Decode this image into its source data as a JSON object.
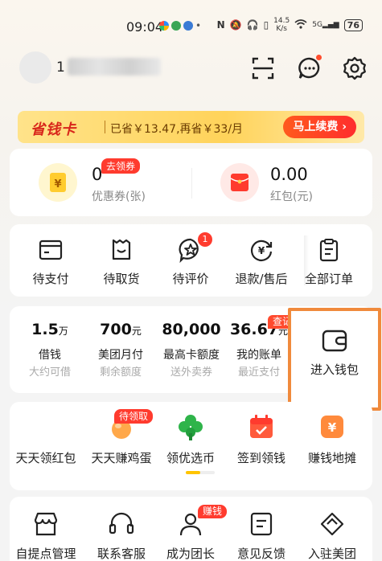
{
  "status_bar": {
    "time": "09:04",
    "net_speed_top": "14.5",
    "net_speed_bottom": "K/s",
    "signal": "5G",
    "battery": "76"
  },
  "header": {
    "username_prefix": "1",
    "scan_icon": "scan-icon",
    "message_icon": "message-icon",
    "settings_icon": "gear-icon"
  },
  "promo": {
    "brand": "省钱卡",
    "text": "已省￥13.47,再省￥33/月",
    "button": "马上续费 ›"
  },
  "coupons": [
    {
      "value": "0",
      "label": "优惠券(张)",
      "badge": "去领券",
      "color": "#ffd34d"
    },
    {
      "value": "0.00",
      "label": "红包(元)",
      "color": "#ff4a3a"
    }
  ],
  "orders": [
    {
      "label": "待支付",
      "icon": "wallet-card-icon"
    },
    {
      "label": "待取货",
      "icon": "bag-icon"
    },
    {
      "label": "待评价",
      "icon": "star-chat-icon",
      "badge": "1"
    },
    {
      "label": "退款/售后",
      "icon": "refund-icon"
    },
    {
      "label": "全部订单",
      "icon": "clipboard-icon"
    }
  ],
  "finance": [
    {
      "value": "1.5",
      "unit": "万",
      "label": "借钱",
      "sub": "大约可借"
    },
    {
      "value": "700",
      "unit": "元",
      "label": "美团月付",
      "sub": "剩余额度"
    },
    {
      "value": "80,000",
      "unit": "",
      "label": "最高卡额度",
      "sub": "送外卖券"
    },
    {
      "value": "36.67",
      "unit": "元",
      "label": "我的账单",
      "sub": "最近支付"
    }
  ],
  "finance_tag": "查记录",
  "wallet": {
    "label": "进入钱包",
    "icon": "wallet-icon"
  },
  "earn": [
    {
      "label": "天天领红包",
      "icon": "red-envelope-icon"
    },
    {
      "label": "天天赚鸡蛋",
      "icon": "egg-icon"
    },
    {
      "label": "领优选币",
      "icon": "clover-icon"
    },
    {
      "label": "签到领钱",
      "icon": "calendar-check-icon"
    },
    {
      "label": "赚钱地摊",
      "icon": "money-stall-icon"
    }
  ],
  "earn_tag": "待领取",
  "services": [
    {
      "label": "自提点管理",
      "icon": "shop-icon"
    },
    {
      "label": "联系客服",
      "icon": "headset-icon"
    },
    {
      "label": "成为团长",
      "icon": "leader-icon"
    },
    {
      "label": "意见反馈",
      "icon": "feedback-icon"
    },
    {
      "label": "入驻美团",
      "icon": "join-icon"
    }
  ],
  "service_tag": "赚钱",
  "watermark": "⌐"
}
